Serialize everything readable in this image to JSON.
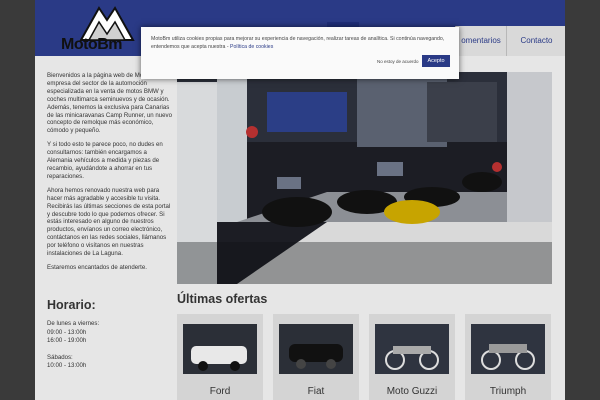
{
  "brand": {
    "name": "MotoBm",
    "header_color": "#2a3a86"
  },
  "nav": {
    "comments": "omentarios",
    "contact": "Contacto"
  },
  "intro": {
    "p1": "Bienvenidos a la página web de MotoBm empresa del sector de la automoción especializada en la venta de motos BMW y coches multimarca seminuevos y de ocasión. Además, tenemos la exclusiva para Canarias de las minicaravanas Camp Runner, un nuevo concepto de remolque más económico, cómodo y pequeño.",
    "p2": "Y si todo esto te parece poco, no dudes en consultarnos: también encargamos a Alemania vehículos a medida y piezas de recambio, ayudándote a ahorrar en tus reparaciones.",
    "p3": "Ahora hemos renovado nuestra web para hacer más agradable y accesible tu visita. Recibirás las últimas secciones de esta portal y descubre todo lo que podemos ofrecer. Si estás interesado en alguno de nuestros productos, envíanos un correo electrónico, contáctanos en las redes sociales, llámanos por teléfono o visítanos en nuestras instalaciones de La Laguna.",
    "p4": "Estaremos encantados de atenderte."
  },
  "hours": {
    "title": "Horario:",
    "weekdays_label": "De lunes a viernes:",
    "weekdays_am": "09:00 - 13:00h",
    "weekdays_pm": "16:00 - 19:00h",
    "saturday_label": "Sábados:",
    "saturday_hours": "10:00 - 13:00h"
  },
  "offers": {
    "title": "Últimas ofertas",
    "items": [
      {
        "name": "Ford"
      },
      {
        "name": "Fiat"
      },
      {
        "name": "Moto Guzzi"
      },
      {
        "name": "Triumph"
      }
    ]
  },
  "cookie": {
    "message": "MotoBm utiliza cookies propias para mejorar su experiencia de navegación, realizar tareas de analítica. Si continúa navegando, entendemos que acepta nuestra - ",
    "policy_link": "Política de cookies",
    "reject": "No estoy de acuerdo",
    "accept": "Acepto"
  }
}
